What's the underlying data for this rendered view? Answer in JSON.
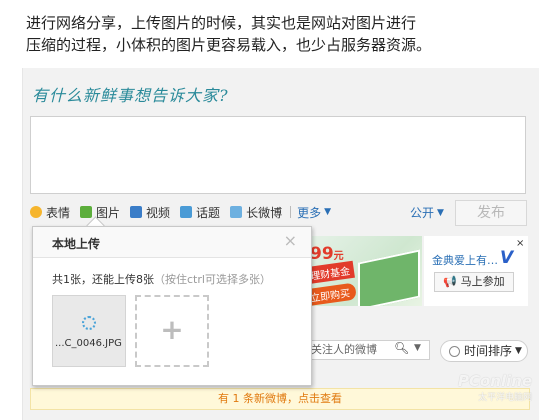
{
  "caption": {
    "line1": "进行网络分享，上传图片的时候，其实也是网站对图片进行",
    "line2": "压缩的过程，小体积的图片更容易载入，也少占服务器资源。"
  },
  "composer": {
    "prompt": "有什么新鲜事想告诉大家?",
    "toolbar": {
      "emoji": "表情",
      "image": "图片",
      "video": "视频",
      "topic": "话题",
      "long_weibo": "长微博",
      "more": "更多"
    },
    "visibility": "公开",
    "post_button": "发布"
  },
  "upload_dialog": {
    "title": "本地上传",
    "close": "×",
    "count_text": "共1张，还能上传8张",
    "hint": "（按住ctrl可选择多张）",
    "file_name": "...C_0046.JPG",
    "add_symbol": "+"
  },
  "ad": {
    "price": "99",
    "price_unit": "元",
    "fund": "理财基金",
    "buy": "立即购买",
    "title": "金典爱上有…",
    "brand_mark": "V",
    "join_button": "马上参加",
    "close": "×"
  },
  "feed": {
    "search_placeholder": "关注人的微博",
    "sort_label": "时间排序",
    "new_notice": "有 1 条新微博，点击查看"
  },
  "watermark": {
    "brand": "PConline",
    "sub": "太平洋电脑网"
  },
  "colors": {
    "link_blue": "#2a6fb5",
    "prompt_teal": "#2a8a9a",
    "notice_orange": "#e07a10"
  }
}
